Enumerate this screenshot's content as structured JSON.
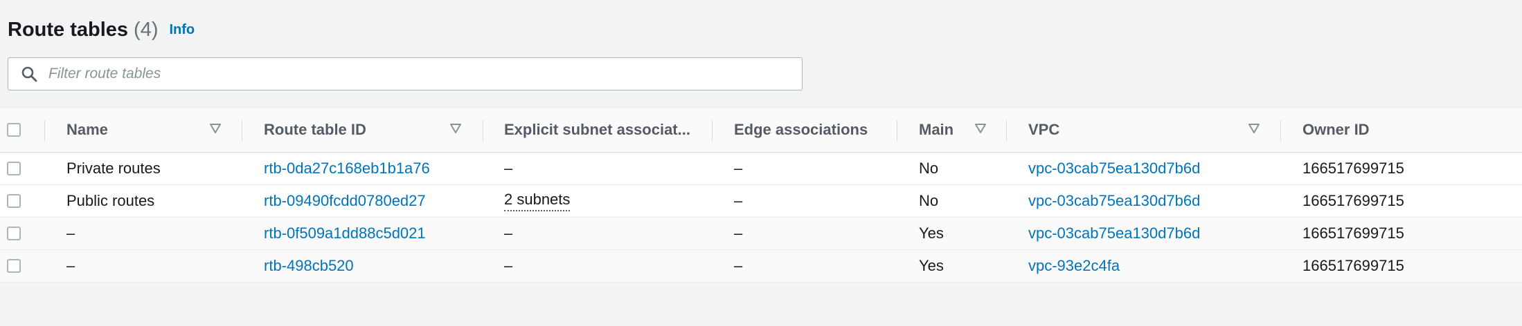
{
  "header": {
    "title": "Route tables",
    "count": "(4)",
    "info_label": "Info"
  },
  "filter": {
    "placeholder": "Filter route tables",
    "value": ""
  },
  "columns": {
    "name": "Name",
    "route_table_id": "Route table ID",
    "explicit_subnet": "Explicit subnet associat...",
    "edge": "Edge associations",
    "main": "Main",
    "vpc": "VPC",
    "owner": "Owner ID"
  },
  "rows": [
    {
      "name": "Private routes",
      "route_table_id": "rtb-0da27c168eb1b1a76",
      "explicit_subnet": "–",
      "edge": "–",
      "main": "No",
      "vpc": "vpc-03cab75ea130d7b6d",
      "owner": "166517699715"
    },
    {
      "name": "Public routes",
      "route_table_id": "rtb-09490fcdd0780ed27",
      "explicit_subnet": "2 subnets",
      "edge": "–",
      "main": "No",
      "vpc": "vpc-03cab75ea130d7b6d",
      "owner": "166517699715"
    },
    {
      "name": "–",
      "route_table_id": "rtb-0f509a1dd88c5d021",
      "explicit_subnet": "–",
      "edge": "–",
      "main": "Yes",
      "vpc": "vpc-03cab75ea130d7b6d",
      "owner": "166517699715"
    },
    {
      "name": "–",
      "route_table_id": "rtb-498cb520",
      "explicit_subnet": "–",
      "edge": "–",
      "main": "Yes",
      "vpc": "vpc-93e2c4fa",
      "owner": "166517699715"
    }
  ],
  "colors": {
    "link": "#0073bb",
    "page_background": "#f2f3f3",
    "header_text": "#545b64"
  }
}
